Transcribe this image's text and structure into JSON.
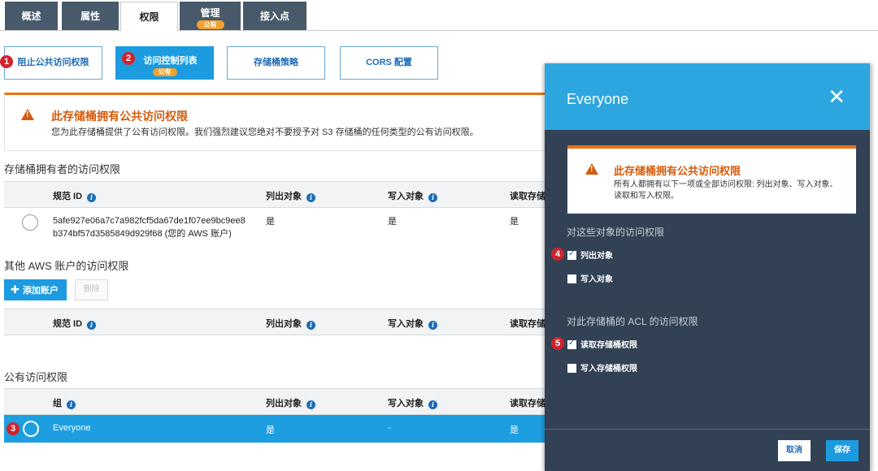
{
  "tabs": [
    {
      "label": "概述"
    },
    {
      "label": "属性"
    },
    {
      "label": "权限"
    },
    {
      "label": "管理",
      "badge": "公有"
    },
    {
      "label": "接入点"
    }
  ],
  "subnav": [
    {
      "label": "阻止公共访问权限",
      "step": "1"
    },
    {
      "label": "访问控制列表",
      "badge": "公有",
      "step": "2"
    },
    {
      "label": "存储桶策略"
    },
    {
      "label": "CORS 配置"
    }
  ],
  "banner": {
    "title": "此存储桶拥有公共访问权限",
    "text": "您为此存储桶提供了公有访问权限。我们强烈建议您绝对不要授予对 S3 存储桶的任何类型的公有访问权限。"
  },
  "owner_section": {
    "title": "存储桶拥有者的访问权限",
    "columns": [
      "规范 ID",
      "列出对象",
      "写入对象",
      "读取存储"
    ],
    "row": {
      "id_line1": "5afe927e06a7c7a982fcf5da67de1f07ee9bc9ee8",
      "id_line2": "b374bf57d3585849d929f68 (您的 AWS 账户)",
      "list": "是",
      "write": "是",
      "read": "是"
    }
  },
  "other_section": {
    "title": "其他 AWS 账户的访问权限",
    "add_label": "添加账户",
    "delete_label": "删除",
    "columns": [
      "规范 ID",
      "列出对象",
      "写入对象",
      "读取存储"
    ]
  },
  "public_section": {
    "title": "公有访问权限",
    "columns": [
      "组",
      "列出对象",
      "写入对象",
      "读取存储"
    ],
    "row": {
      "step": "3",
      "group": "Everyone",
      "list": "是",
      "write": "-",
      "read": "是"
    }
  },
  "modal": {
    "title": "Everyone",
    "warn_title": "此存储桶拥有公共访问权限",
    "warn_text": "所有人都拥有以下一项或全部访问权限: 列出对象、写入对象、读取和写入权限。",
    "objects_section": "对这些对象的访问权限",
    "acl_section": "对此存储桶的 ACL 的访问权限",
    "checkboxes": [
      {
        "label": "列出对象",
        "checked": true,
        "step": "4"
      },
      {
        "label": "写入对象",
        "checked": false
      },
      {
        "label": "读取存储桶权限",
        "checked": true,
        "step": "5"
      },
      {
        "label": "写入存储桶权限",
        "checked": false
      }
    ],
    "cancel_label": "取消",
    "save_label": "保存"
  },
  "colors": {
    "accent": "#1c9be0",
    "warning": "#ec7211",
    "tab_bg": "#48596b",
    "modal_bg": "#324254",
    "step_badge": "#d0232d"
  }
}
